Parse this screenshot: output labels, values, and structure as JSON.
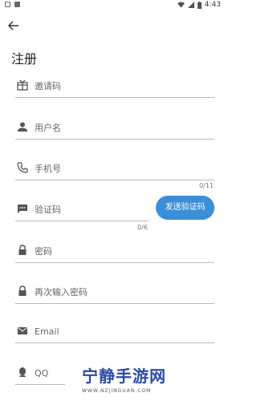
{
  "status": {
    "time": "4:43"
  },
  "title": "注册",
  "fields": {
    "invite": {
      "placeholder": "邀请码"
    },
    "username": {
      "placeholder": "用户名"
    },
    "phone": {
      "placeholder": "手机号",
      "counter": "0/11"
    },
    "code": {
      "placeholder": "验证码",
      "counter": "0/6"
    },
    "password": {
      "placeholder": "密码"
    },
    "password_confirm": {
      "placeholder": "再次输入密码"
    },
    "email": {
      "placeholder": "Email"
    },
    "qq": {
      "placeholder": "QQ"
    }
  },
  "send_code_label": "发送验证码",
  "watermark": {
    "name": "宁静手游网",
    "url": "WWW.NZJINGUAN.COM"
  },
  "colors": {
    "accent": "#3b8fd9",
    "watermark": "#2b4aa8"
  }
}
